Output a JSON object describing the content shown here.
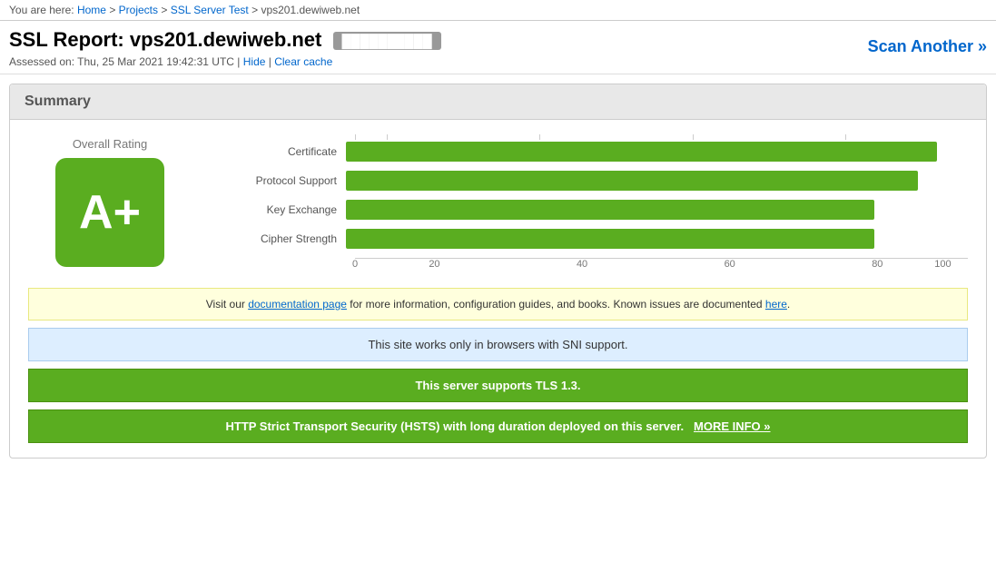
{
  "breadcrumb": {
    "prefix": "You are here:",
    "items": [
      {
        "label": "Home",
        "href": "#"
      },
      {
        "label": "Projects",
        "href": "#"
      },
      {
        "label": "SSL Server Test",
        "href": "#"
      },
      {
        "label": "vps201.dewiweb.net",
        "href": "#"
      }
    ]
  },
  "header": {
    "title_prefix": "SSL Report:",
    "hostname": "vps201.dewiweb.net",
    "ip_label": "██████████",
    "assessed_label": "Assessed on:",
    "assessed_date": "Thu, 25 Mar 2021 19:42:31 UTC",
    "hide_label": "Hide",
    "clear_cache_label": "Clear cache",
    "scan_another_label": "Scan Another »"
  },
  "summary": {
    "section_title": "Summary",
    "overall_rating_label": "Overall Rating",
    "grade": "A+",
    "bars": [
      {
        "label": "Certificate",
        "value": 95,
        "max": 100
      },
      {
        "label": "Protocol Support",
        "value": 92,
        "max": 100
      },
      {
        "label": "Key Exchange",
        "value": 85,
        "max": 100
      },
      {
        "label": "Cipher Strength",
        "value": 85,
        "max": 100
      }
    ],
    "axis_labels": [
      "0",
      "20",
      "40",
      "60",
      "80",
      "100"
    ],
    "notice": {
      "text_before": "Visit our ",
      "link1_label": "documentation page",
      "text_middle": " for more information, configuration guides, and books. Known issues are documented ",
      "link2_label": "here",
      "text_after": "."
    },
    "sni_box": "This site works only in browsers with SNI support.",
    "tls_box": "This server supports TLS 1.3.",
    "hsts_box_text": "HTTP Strict Transport Security (HSTS) with long duration deployed on this server.",
    "hsts_link_label": "MORE INFO »"
  }
}
